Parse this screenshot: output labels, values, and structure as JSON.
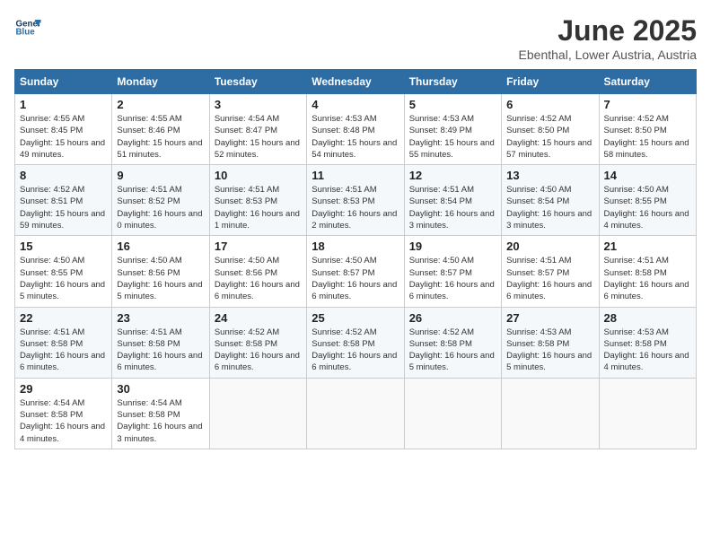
{
  "logo": {
    "line1": "General",
    "line2": "Blue"
  },
  "title": "June 2025",
  "location": "Ebenthal, Lower Austria, Austria",
  "weekdays": [
    "Sunday",
    "Monday",
    "Tuesday",
    "Wednesday",
    "Thursday",
    "Friday",
    "Saturday"
  ],
  "weeks": [
    [
      {
        "day": "1",
        "sunrise": "4:55 AM",
        "sunset": "8:45 PM",
        "daylight": "15 hours and 49 minutes."
      },
      {
        "day": "2",
        "sunrise": "4:55 AM",
        "sunset": "8:46 PM",
        "daylight": "15 hours and 51 minutes."
      },
      {
        "day": "3",
        "sunrise": "4:54 AM",
        "sunset": "8:47 PM",
        "daylight": "15 hours and 52 minutes."
      },
      {
        "day": "4",
        "sunrise": "4:53 AM",
        "sunset": "8:48 PM",
        "daylight": "15 hours and 54 minutes."
      },
      {
        "day": "5",
        "sunrise": "4:53 AM",
        "sunset": "8:49 PM",
        "daylight": "15 hours and 55 minutes."
      },
      {
        "day": "6",
        "sunrise": "4:52 AM",
        "sunset": "8:50 PM",
        "daylight": "15 hours and 57 minutes."
      },
      {
        "day": "7",
        "sunrise": "4:52 AM",
        "sunset": "8:50 PM",
        "daylight": "15 hours and 58 minutes."
      }
    ],
    [
      {
        "day": "8",
        "sunrise": "4:52 AM",
        "sunset": "8:51 PM",
        "daylight": "15 hours and 59 minutes."
      },
      {
        "day": "9",
        "sunrise": "4:51 AM",
        "sunset": "8:52 PM",
        "daylight": "16 hours and 0 minutes."
      },
      {
        "day": "10",
        "sunrise": "4:51 AM",
        "sunset": "8:53 PM",
        "daylight": "16 hours and 1 minute."
      },
      {
        "day": "11",
        "sunrise": "4:51 AM",
        "sunset": "8:53 PM",
        "daylight": "16 hours and 2 minutes."
      },
      {
        "day": "12",
        "sunrise": "4:51 AM",
        "sunset": "8:54 PM",
        "daylight": "16 hours and 3 minutes."
      },
      {
        "day": "13",
        "sunrise": "4:50 AM",
        "sunset": "8:54 PM",
        "daylight": "16 hours and 3 minutes."
      },
      {
        "day": "14",
        "sunrise": "4:50 AM",
        "sunset": "8:55 PM",
        "daylight": "16 hours and 4 minutes."
      }
    ],
    [
      {
        "day": "15",
        "sunrise": "4:50 AM",
        "sunset": "8:55 PM",
        "daylight": "16 hours and 5 minutes."
      },
      {
        "day": "16",
        "sunrise": "4:50 AM",
        "sunset": "8:56 PM",
        "daylight": "16 hours and 5 minutes."
      },
      {
        "day": "17",
        "sunrise": "4:50 AM",
        "sunset": "8:56 PM",
        "daylight": "16 hours and 6 minutes."
      },
      {
        "day": "18",
        "sunrise": "4:50 AM",
        "sunset": "8:57 PM",
        "daylight": "16 hours and 6 minutes."
      },
      {
        "day": "19",
        "sunrise": "4:50 AM",
        "sunset": "8:57 PM",
        "daylight": "16 hours and 6 minutes."
      },
      {
        "day": "20",
        "sunrise": "4:51 AM",
        "sunset": "8:57 PM",
        "daylight": "16 hours and 6 minutes."
      },
      {
        "day": "21",
        "sunrise": "4:51 AM",
        "sunset": "8:58 PM",
        "daylight": "16 hours and 6 minutes."
      }
    ],
    [
      {
        "day": "22",
        "sunrise": "4:51 AM",
        "sunset": "8:58 PM",
        "daylight": "16 hours and 6 minutes."
      },
      {
        "day": "23",
        "sunrise": "4:51 AM",
        "sunset": "8:58 PM",
        "daylight": "16 hours and 6 minutes."
      },
      {
        "day": "24",
        "sunrise": "4:52 AM",
        "sunset": "8:58 PM",
        "daylight": "16 hours and 6 minutes."
      },
      {
        "day": "25",
        "sunrise": "4:52 AM",
        "sunset": "8:58 PM",
        "daylight": "16 hours and 6 minutes."
      },
      {
        "day": "26",
        "sunrise": "4:52 AM",
        "sunset": "8:58 PM",
        "daylight": "16 hours and 5 minutes."
      },
      {
        "day": "27",
        "sunrise": "4:53 AM",
        "sunset": "8:58 PM",
        "daylight": "16 hours and 5 minutes."
      },
      {
        "day": "28",
        "sunrise": "4:53 AM",
        "sunset": "8:58 PM",
        "daylight": "16 hours and 4 minutes."
      }
    ],
    [
      {
        "day": "29",
        "sunrise": "4:54 AM",
        "sunset": "8:58 PM",
        "daylight": "16 hours and 4 minutes."
      },
      {
        "day": "30",
        "sunrise": "4:54 AM",
        "sunset": "8:58 PM",
        "daylight": "16 hours and 3 minutes."
      },
      null,
      null,
      null,
      null,
      null
    ]
  ]
}
